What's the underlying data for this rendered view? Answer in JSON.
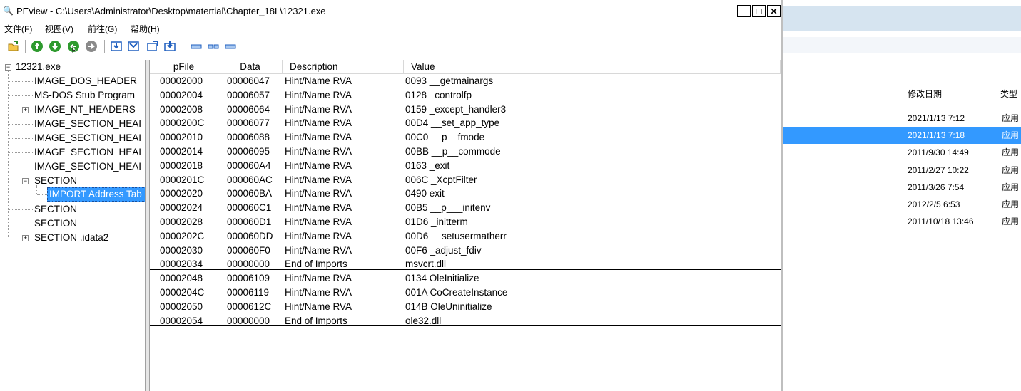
{
  "window": {
    "title": "PEview - C:\\Users\\Administrator\\Desktop\\matertial\\Chapter_18L\\12321.exe",
    "controls": {
      "minimize": "_",
      "maximize": "□",
      "close": "✕"
    }
  },
  "menu": [
    "文件(F)",
    "视图(V)",
    "前往(G)",
    "帮助(H)"
  ],
  "toolbar": [
    "open-icon",
    "forward-icon",
    "back-icon",
    "up-icon",
    "next-icon",
    "view-tree-icon",
    "view-data-icon",
    "view-export-icon",
    "view-import-icon",
    "view-hex-icon",
    "view-word-icon",
    "view-dword-icon"
  ],
  "tree": {
    "root": "12321.exe",
    "items": [
      "IMAGE_DOS_HEADER",
      "MS-DOS Stub Program",
      "IMAGE_NT_HEADERS",
      "IMAGE_SECTION_HEAI",
      "IMAGE_SECTION_HEAI",
      "IMAGE_SECTION_HEAI",
      "IMAGE_SECTION_HEAI",
      "SECTION",
      "IMPORT Address Tab",
      "SECTION",
      "SECTION",
      "SECTION .idata2"
    ]
  },
  "grid": {
    "columns": [
      "pFile",
      "Data",
      "Description",
      "Value"
    ],
    "group1": [
      [
        "00002000",
        "00006047",
        "Hint/Name RVA",
        "0093  __getmainargs"
      ],
      [
        "00002004",
        "00006057",
        "Hint/Name RVA",
        "0128  _controlfp"
      ],
      [
        "00002008",
        "00006064",
        "Hint/Name RVA",
        "0159  _except_handler3"
      ],
      [
        "0000200C",
        "00006077",
        "Hint/Name RVA",
        "00D4  __set_app_type"
      ],
      [
        "00002010",
        "00006088",
        "Hint/Name RVA",
        "00C0  __p__fmode"
      ],
      [
        "00002014",
        "00006095",
        "Hint/Name RVA",
        "00BB  __p__commode"
      ],
      [
        "00002018",
        "000060A4",
        "Hint/Name RVA",
        "0163  _exit"
      ],
      [
        "0000201C",
        "000060AC",
        "Hint/Name RVA",
        "006C  _XcptFilter"
      ],
      [
        "00002020",
        "000060BA",
        "Hint/Name RVA",
        "0490  exit"
      ],
      [
        "00002024",
        "000060C1",
        "Hint/Name RVA",
        "00B5  __p___initenv"
      ],
      [
        "00002028",
        "000060D1",
        "Hint/Name RVA",
        "01D6  _initterm"
      ],
      [
        "0000202C",
        "000060DD",
        "Hint/Name RVA",
        "00D6  __setusermatherr"
      ],
      [
        "00002030",
        "000060F0",
        "Hint/Name RVA",
        "00F6  _adjust_fdiv"
      ],
      [
        "00002034",
        "00000000",
        "End of Imports",
        "msvcrt.dll"
      ]
    ],
    "group2": [
      [
        "00002048",
        "00006109",
        "Hint/Name RVA",
        "0134  OleInitialize"
      ],
      [
        "0000204C",
        "00006119",
        "Hint/Name RVA",
        "001A  CoCreateInstance"
      ],
      [
        "00002050",
        "0000612C",
        "Hint/Name RVA",
        "014B  OleUninitialize"
      ],
      [
        "00002054",
        "00000000",
        "End of Imports",
        "ole32.dll"
      ]
    ]
  },
  "explorer": {
    "columns": [
      "修改日期",
      "类型"
    ],
    "rows": [
      [
        "2021/1/13 7:12",
        "应用"
      ],
      [
        "2021/1/13 7:18",
        "应用"
      ],
      [
        "2011/9/30 14:49",
        "应用"
      ],
      [
        "2011/2/27 10:22",
        "应用"
      ],
      [
        "2011/3/26 7:54",
        "应用"
      ],
      [
        "2012/2/5 6:53",
        "应用"
      ],
      [
        "2011/10/18 13:46",
        "应用"
      ]
    ],
    "selected_row": 1
  }
}
